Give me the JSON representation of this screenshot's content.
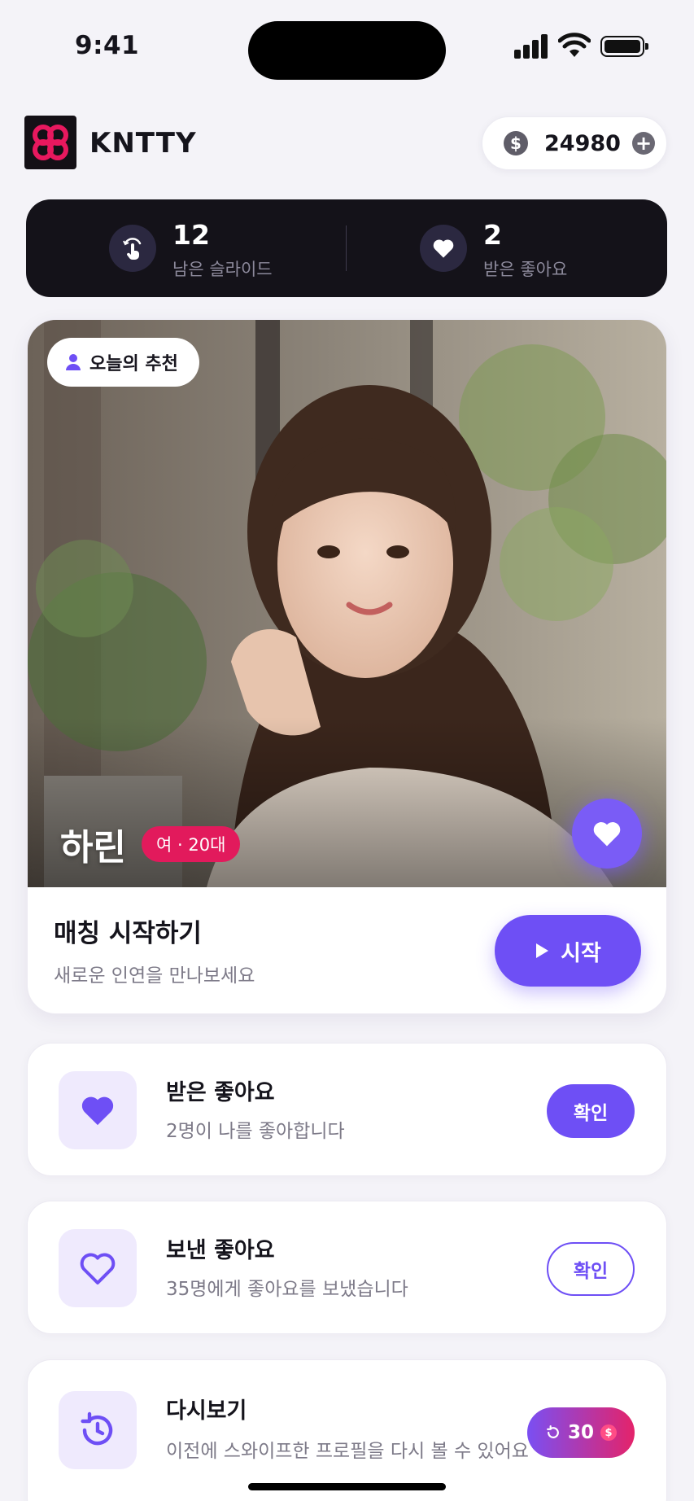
{
  "status_bar": {
    "time": "9:41"
  },
  "header": {
    "app_name": "KNTTY",
    "coins": "24980"
  },
  "stats": {
    "slides_count": "12",
    "slides_label": "남은 슬라이드",
    "likes_count": "2",
    "likes_label": "받은 좋아요"
  },
  "profile": {
    "recommend_label": "오늘의 추천",
    "name": "하린",
    "tag": "여 · 20대",
    "match_title": "매칭 시작하기",
    "match_subtitle": "새로운 인연을 만나보세요",
    "start_label": "시작"
  },
  "list": [
    {
      "title": "받은 좋아요",
      "desc": "2명이 나를 좋아합니다",
      "button": "확인",
      "icon": "heart-filled-icon"
    },
    {
      "title": "보낸 좋아요",
      "desc": "35명에게 좋아요를 보냈습니다",
      "button": "확인",
      "icon": "heart-outline-icon"
    },
    {
      "title": "다시보기",
      "desc": "이전에 스와이프한 프로필을 다시 볼 수 있어요",
      "button": "30",
      "icon": "history-icon"
    }
  ],
  "colors": {
    "accent": "#6e4ff5",
    "pink": "#e21a5c",
    "dark_bar": "#141219",
    "background": "#f4f3f8"
  }
}
